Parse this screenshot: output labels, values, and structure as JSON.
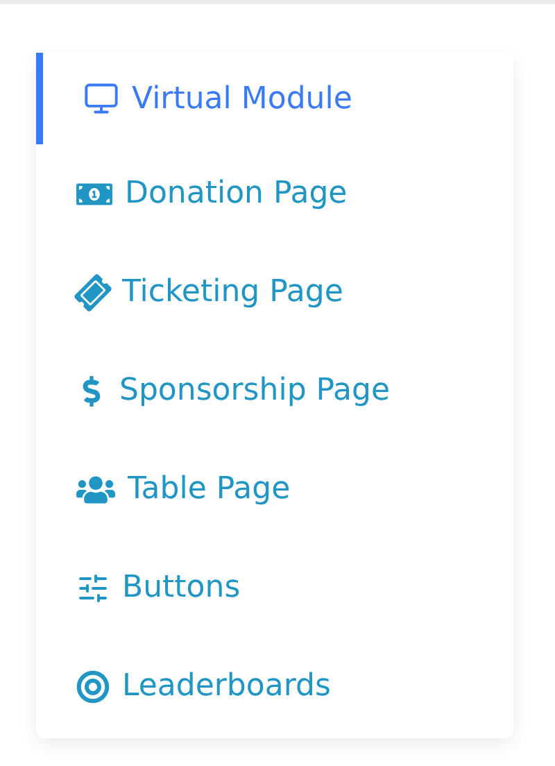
{
  "sidebar": {
    "items": [
      {
        "label": "Virtual Module",
        "selected": true
      },
      {
        "label": "Donation Page",
        "selected": false
      },
      {
        "label": "Ticketing Page",
        "selected": false
      },
      {
        "label": "Sponsorship Page",
        "selected": false
      },
      {
        "label": "Table Page",
        "selected": false
      },
      {
        "label": "Buttons",
        "selected": false
      },
      {
        "label": "Leaderboards",
        "selected": false
      }
    ]
  }
}
